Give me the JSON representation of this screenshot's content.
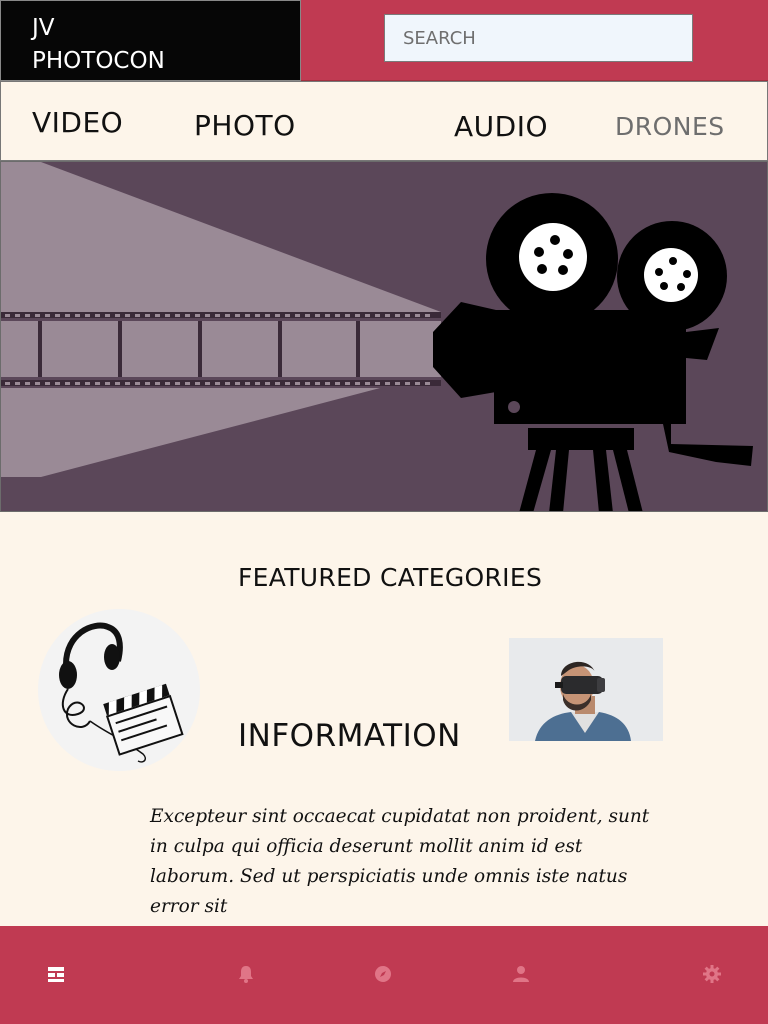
{
  "header": {
    "brand_line1": "JV",
    "brand_line2": "PHOTOCON",
    "search_placeholder": "SEARCH"
  },
  "nav": {
    "items": [
      {
        "label": "VIDEO"
      },
      {
        "label": "PHOTO"
      },
      {
        "label": "AUDIO"
      },
      {
        "label": "DRONES"
      }
    ]
  },
  "hero": {
    "icon": "movie-camera-icon"
  },
  "featured": {
    "title": "FEATURED CATEGORIES",
    "info_title": "INFORMATION",
    "info_text": "Excepteur sint occaecat cupidatat non proident, sunt in culpa qui officia deserunt mollit anim id est laborum. Sed ut perspiciatis unde omnis iste natus error sit"
  },
  "bottom_tabs": [
    {
      "icon": "dashboard-icon"
    },
    {
      "icon": "bell-icon"
    },
    {
      "icon": "compass-icon"
    },
    {
      "icon": "user-icon"
    },
    {
      "icon": "gear-icon"
    }
  ],
  "colors": {
    "accent": "#c03a52",
    "background": "#fdf5ea",
    "hero_bg": "#5b4759"
  }
}
